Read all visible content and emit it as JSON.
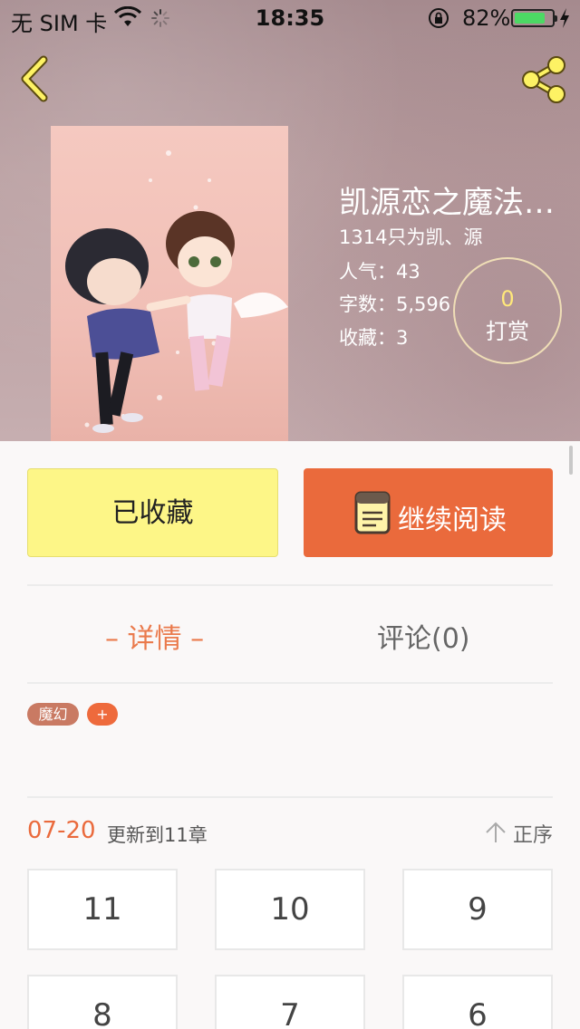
{
  "status_bar": {
    "carrier": "无 SIM 卡",
    "time": "18:35",
    "battery_percent": "82%",
    "battery_level": 0.82
  },
  "book": {
    "title": "凯源恋之魔法…",
    "author": "1314只为凯、源",
    "popularity": "人气：43",
    "word_count": "字数：5,596",
    "favorites": "收藏：3"
  },
  "tip": {
    "count": "0",
    "label": "打赏"
  },
  "actions": {
    "favorite_label": "已收藏",
    "read_label": "继续阅读"
  },
  "tabs": {
    "details": "– 详情 –",
    "comments": "评论(0)"
  },
  "tags": {
    "genre": "魔幻",
    "add": "+"
  },
  "update": {
    "date": "07-20",
    "text": "更新到11章",
    "sort_label": "正序"
  },
  "chapters": [
    "11",
    "10",
    "9",
    "8",
    "7",
    "6"
  ],
  "colors": {
    "accent_orange": "#ea6a3c",
    "favorite_yellow": "#fdf687",
    "tip_number": "#ffe87a",
    "tag_genre": "#c97a63"
  },
  "icons": [
    "back-icon",
    "share-icon",
    "wifi-icon",
    "spinner-icon",
    "orientation-lock-icon",
    "battery-icon",
    "charging-icon",
    "book-icon",
    "sort-up-arrow-icon"
  ]
}
